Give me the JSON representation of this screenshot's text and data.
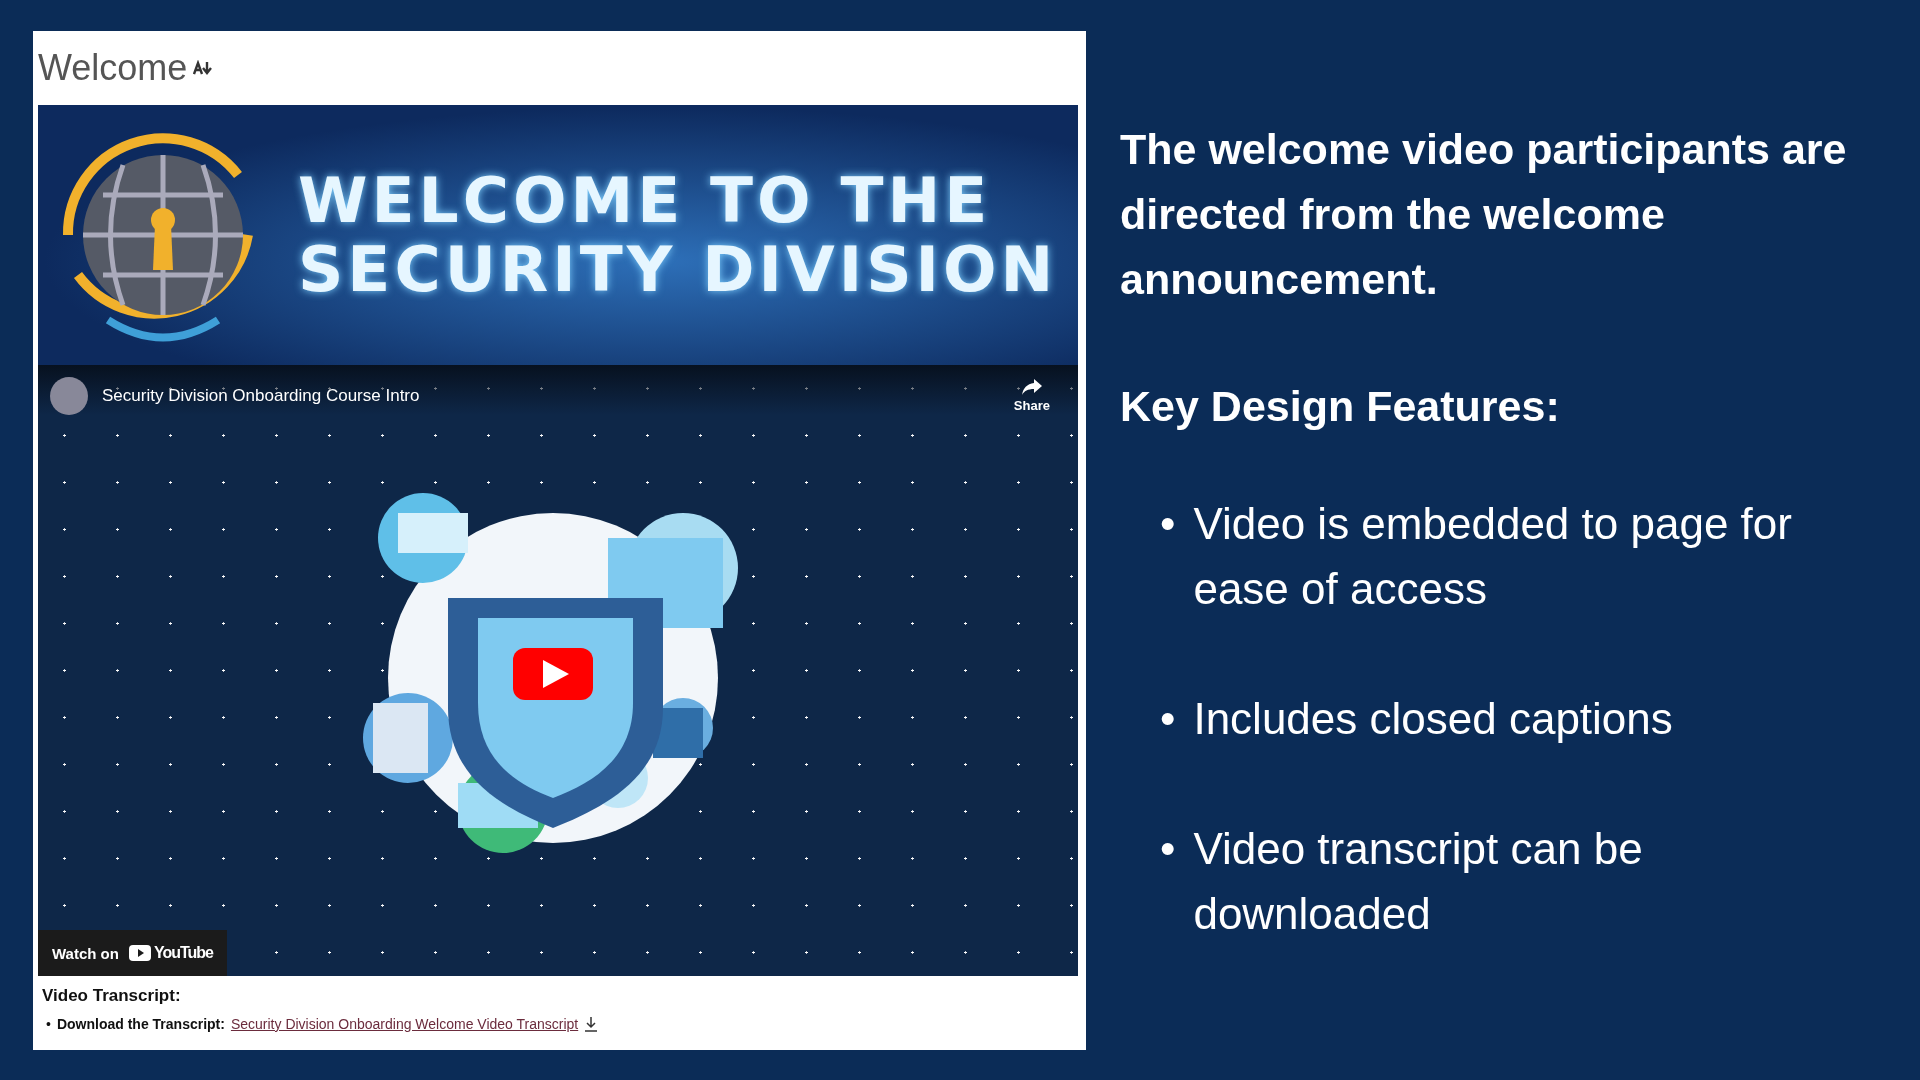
{
  "page": {
    "title": "Welcome"
  },
  "banner": {
    "heading_lines": [
      "WELCOME TO THE",
      "SECURITY DIVISION"
    ]
  },
  "video": {
    "title": "Security Division Onboarding Course Intro",
    "share_label": "Share",
    "watch_on": "Watch on",
    "platform": "YouTube"
  },
  "transcript": {
    "heading": "Video Transcript:",
    "items": [
      {
        "marker": "•",
        "label": "Download the Transcript:",
        "link": "Security Division Onboarding Welcome Video Transcript"
      }
    ]
  },
  "notes": {
    "intro": "The welcome video participants are directed from the welcome announcement.",
    "features_heading": "Key Design Features:",
    "features": [
      {
        "marker": "•",
        "text": "Video is embedded to page for ease of access"
      },
      {
        "marker": "•",
        "text": "Includes closed captions"
      },
      {
        "marker": "•",
        "text": "Video transcript can be downloaded"
      }
    ]
  }
}
